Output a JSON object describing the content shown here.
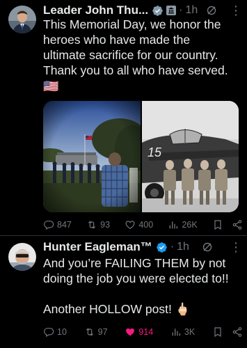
{
  "post1": {
    "author": "Leader John Thu...",
    "time": "1h",
    "text_lines": [
      "This Memorial Day, we honor the",
      "heroes who have made the",
      "ultimate sacrifice for our country.",
      "Thank you to all who have served."
    ],
    "flag": "🇺🇸",
    "stats": {
      "replies": "847",
      "reposts": "93",
      "likes": "400",
      "views": "26K"
    },
    "image_overlay": "15"
  },
  "post2": {
    "author": "Hunter Eagleman™",
    "time": "1h",
    "text_lines": [
      "And you’re FAILING THEM by not",
      "doing the job you were elected to!!"
    ],
    "text_line3": "Another HOLLOW post! 🖕🏻",
    "stats": {
      "replies": "10",
      "reposts": "97",
      "likes": "914",
      "views": "3K"
    }
  },
  "colors": {
    "background": "#000000",
    "text": "#e7e9ea",
    "muted": "#71767b",
    "verified": "#1d9bf0",
    "like_active": "#f91880"
  }
}
